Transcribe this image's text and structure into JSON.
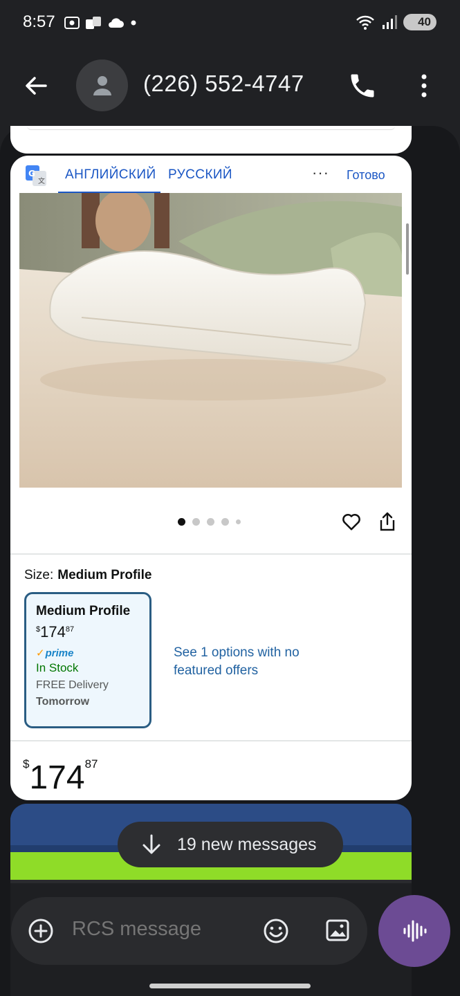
{
  "status_bar": {
    "time": "8:57",
    "battery": "40",
    "icons_left": [
      "screenshot-icon",
      "apps-icon",
      "cloud-icon",
      "dot-icon"
    ],
    "icons_right": [
      "wifi-icon",
      "signal-icon",
      "battery-icon"
    ]
  },
  "header": {
    "contact": "(226) 552-4747",
    "icons": [
      "back-arrow-icon",
      "person-icon",
      "phone-icon",
      "more-vert-icon"
    ]
  },
  "translate_bar": {
    "source_lang": "АНГЛИЙСКИЙ",
    "target_lang": "РУССКИЙ",
    "more": "···",
    "done": "Готово"
  },
  "product": {
    "image_alt": "Contoured memory foam pillow",
    "carousel_count": 5,
    "carousel_active": 1,
    "size_label": "Size:",
    "size_value": "Medium Profile",
    "option": {
      "title": "Medium Profile",
      "currency": "$",
      "price_whole": "174",
      "price_cents": "87",
      "prime": "prime",
      "stock": "In Stock",
      "delivery": "FREE Delivery",
      "delivery_day": "Tomorrow"
    },
    "see_options": "See 1 options with no featured offers",
    "price": {
      "currency": "$",
      "whole": "174",
      "cents": "87"
    }
  },
  "new_messages": {
    "label": "19 new messages"
  },
  "compose": {
    "placeholder": "RCS message"
  },
  "colors": {
    "background": "#202124",
    "accent_link": "#1a56c4",
    "voice_button": "#6c4b94",
    "selected_border": "#2a5d83",
    "in_stock": "#007600"
  }
}
